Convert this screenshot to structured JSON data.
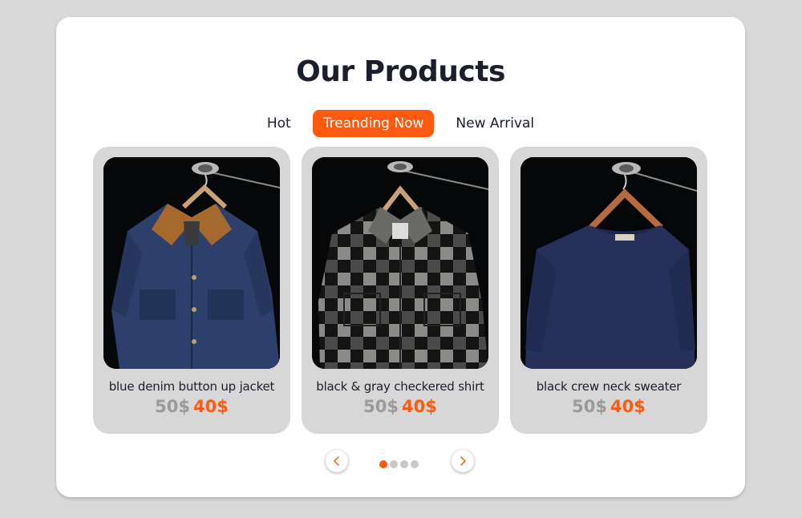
{
  "section": {
    "title": "Our Products"
  },
  "tabs": [
    {
      "label": "Hot",
      "active": false
    },
    {
      "label": "Treanding Now",
      "active": true
    },
    {
      "label": "New Arrival",
      "active": false
    }
  ],
  "products": [
    {
      "name": "blue denim button up jacket",
      "old_price": "50$",
      "new_price": "40$"
    },
    {
      "name": "black & gray checkered shirt",
      "old_price": "50$",
      "new_price": "40$"
    },
    {
      "name": "black crew neck sweater",
      "old_price": "50$",
      "new_price": "40$"
    }
  ],
  "carousel": {
    "prev_icon": "chevron-left-icon",
    "next_icon": "chevron-right-icon",
    "page_count": 4,
    "active_page": 1
  },
  "colors": {
    "accent": "#ff5a0f",
    "old_price": "#9a9a9a",
    "card_bg": "#d7d7d7",
    "page_bg": "#d9d9d9"
  }
}
